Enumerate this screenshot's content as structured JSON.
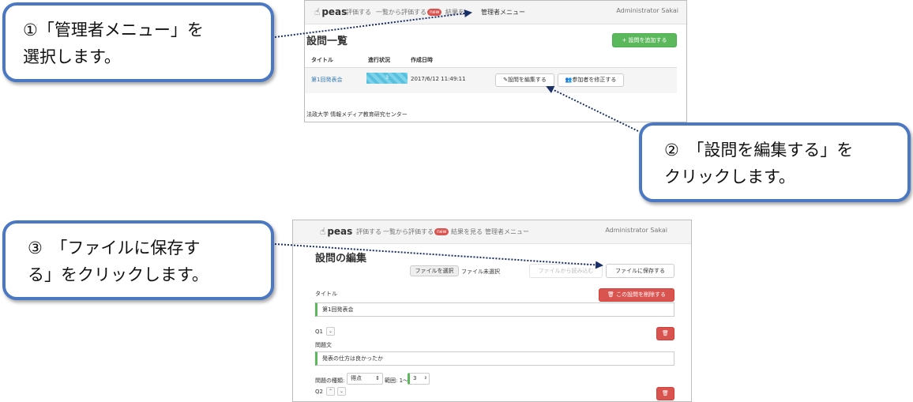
{
  "callouts": {
    "c1": {
      "line1": "①「管理者メニュー」を",
      "line2": "選択します。"
    },
    "c2": {
      "line1": "②　「設問を編集する」を",
      "line2": "クリックします。"
    },
    "c3": {
      "line1": "③　「ファイルに保存す",
      "line2": "る」をクリックします。"
    }
  },
  "top_shot": {
    "nav": {
      "brand": "peas",
      "items": [
        "評価する",
        "一覧から評価する",
        "結果を",
        "管理者メニュー"
      ],
      "new_badge": "new",
      "user": "Administrator Sakai"
    },
    "page_title": "設問一覧",
    "add_button": "+ 設問を追加する",
    "table": {
      "headers": [
        "タイトル",
        "進行状況",
        "作成日時"
      ],
      "row": {
        "title": "第1回発表会",
        "progress": "3",
        "created": "2017/6/12 11:49:11",
        "edit_button": "✎設問を編集する",
        "participants_button": "参加者を修正する"
      }
    },
    "footer": "法政大学 情報メディア教育研究センター"
  },
  "bottom_shot": {
    "nav": {
      "brand": "peas",
      "items": [
        "評価する",
        "一覧から評価する",
        "結果を見る",
        "管理者メニュー"
      ],
      "new_badge": "new",
      "user": "Administrator Sakai"
    },
    "page_title": "設問の編集",
    "file_select": "ファイルを選択",
    "file_none": "ファイル未選択",
    "load_button": "ファイルから読み込む",
    "save_button": "ファイルに保存する",
    "title_label": "タイトル",
    "delete_set_button": "🗑 この設問を削除する",
    "title_value": "第1回発表会",
    "q1_label": "Q1",
    "question_text_label": "問題文",
    "question_text_value": "発表の仕方は良かったか",
    "type_label": "問題の種類:",
    "type_value": "得点",
    "range_label": "範囲: 1〜",
    "range_value": "3",
    "q2_label": "Q2"
  },
  "colors": {
    "callout_border": "#4a78c2",
    "arrow": "#1a2f66",
    "accent_green": "#5cb85c",
    "danger_red": "#d9534f"
  }
}
